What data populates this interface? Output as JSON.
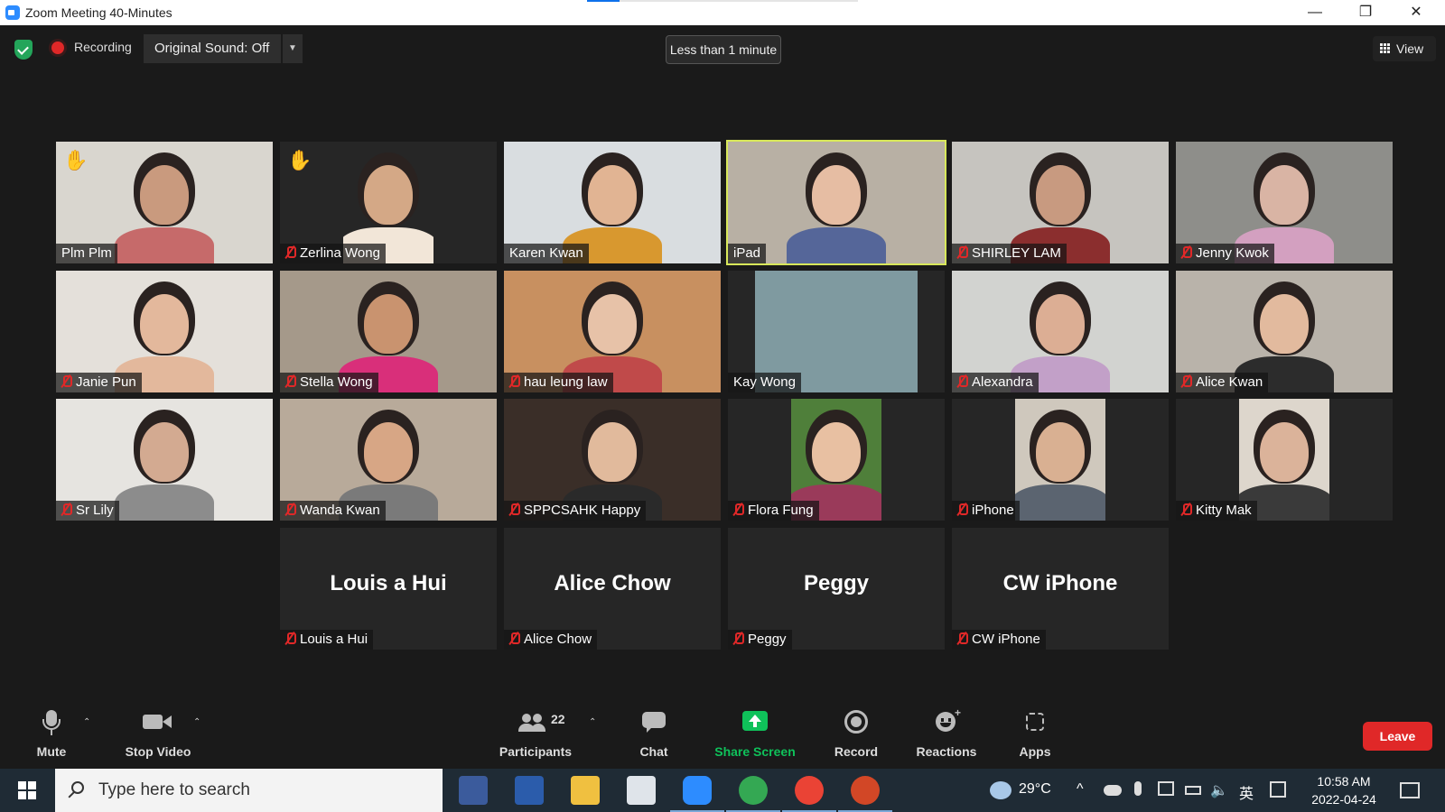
{
  "window": {
    "title": "Zoom Meeting 40-Minutes",
    "minimize": "—",
    "restore": "❐",
    "close": "✕",
    "loading_progress": 0.12
  },
  "topbar": {
    "recording_label": "Recording",
    "original_sound": "Original Sound: Off",
    "dropdown_caret": "▼",
    "timer": "Less than 1 minute",
    "view_label": "View"
  },
  "participants": [
    {
      "name": "Plm Plm",
      "muted": false,
      "hand": true
    },
    {
      "name": "Zerlina Wong",
      "muted": true,
      "hand": true
    },
    {
      "name": "Karen Kwan",
      "muted": false,
      "hand": false
    },
    {
      "name": "iPad",
      "muted": false,
      "hand": false,
      "active": true
    },
    {
      "name": "SHIRLEY LAM",
      "muted": true,
      "hand": false
    },
    {
      "name": "Jenny Kwok",
      "muted": true,
      "hand": false
    },
    {
      "name": "Janie Pun",
      "muted": true,
      "hand": false
    },
    {
      "name": "Stella Wong",
      "muted": true,
      "hand": false
    },
    {
      "name": "hau leung law",
      "muted": true,
      "hand": false
    },
    {
      "name": "Kay Wong",
      "muted": false,
      "hand": false
    },
    {
      "name": "Alexandra",
      "muted": true,
      "hand": false
    },
    {
      "name": "Alice Kwan",
      "muted": true,
      "hand": false
    },
    {
      "name": "Sr Lily",
      "muted": true,
      "hand": false
    },
    {
      "name": "Wanda Kwan",
      "muted": true,
      "hand": false
    },
    {
      "name": "SPPCSAHK Happy",
      "muted": true,
      "hand": false
    },
    {
      "name": "Flora Fung",
      "muted": true,
      "hand": false
    },
    {
      "name": "iPhone",
      "muted": true,
      "hand": false
    },
    {
      "name": "Kitty Mak",
      "muted": true,
      "hand": false
    },
    {
      "name": "Louis a Hui",
      "muted": true,
      "hand": false,
      "video_off": true
    },
    {
      "name": "Alice Chow",
      "muted": true,
      "hand": false,
      "video_off": true
    },
    {
      "name": "Peggy",
      "muted": true,
      "hand": false,
      "video_off": true
    },
    {
      "name": "CW iPhone",
      "muted": true,
      "hand": false,
      "video_off": true
    }
  ],
  "hand_icon": "✋",
  "toolbar": {
    "mute": "Mute",
    "stop_video": "Stop Video",
    "participants": "Participants",
    "participants_count": "22",
    "chat": "Chat",
    "share_screen": "Share Screen",
    "record": "Record",
    "reactions": "Reactions",
    "apps": "Apps",
    "leave": "Leave",
    "caret": "⌃"
  },
  "taskbar": {
    "search_placeholder": "Type here to search",
    "weather_temp": "29°C",
    "ime_label": "英",
    "time": "10:58 AM",
    "date": "2022-04-24"
  },
  "colors": {
    "accent_green": "#23a55a",
    "leave_red": "#e02828",
    "share_green": "#0fc15a",
    "active_speaker": "#d8e85a"
  }
}
